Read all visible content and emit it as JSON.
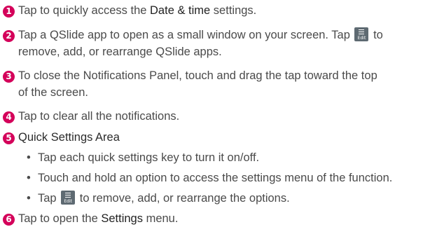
{
  "items": [
    {
      "number": "1",
      "pre": "Tap to quickly access the ",
      "bold": "Date & time",
      "post": " settings."
    },
    {
      "number": "2",
      "pre": "Tap a QSlide app to open as a small window on your screen. Tap ",
      "icon": "edit-icon",
      "post_line1": " to",
      "line2": "remove, add, or rearrange QSlide apps."
    },
    {
      "number": "3",
      "line1": "To close the Notifications Panel, touch and drag the tap toward the top",
      "line2": "of the screen."
    },
    {
      "number": "4",
      "text": "Tap to clear all the notifications."
    },
    {
      "number": "5",
      "heading": "Quick Settings Area",
      "bullets": [
        "Tap each quick settings key to turn it on/off.",
        "Touch and hold an option to access the settings menu of the function.",
        {
          "pre": "Tap ",
          "icon": "edit-icon",
          "post": " to remove, add, or rearrange the options."
        }
      ]
    },
    {
      "number": "6",
      "pre": "Tap to open the ",
      "bold": "Settings",
      "post": " menu."
    }
  ],
  "icon_label": "Edit",
  "bullet_glyph": "•",
  "colors": {
    "number_badge": "#d4005a",
    "text": "#4a4a4a",
    "edit_icon_bg": "#5e6a72"
  }
}
